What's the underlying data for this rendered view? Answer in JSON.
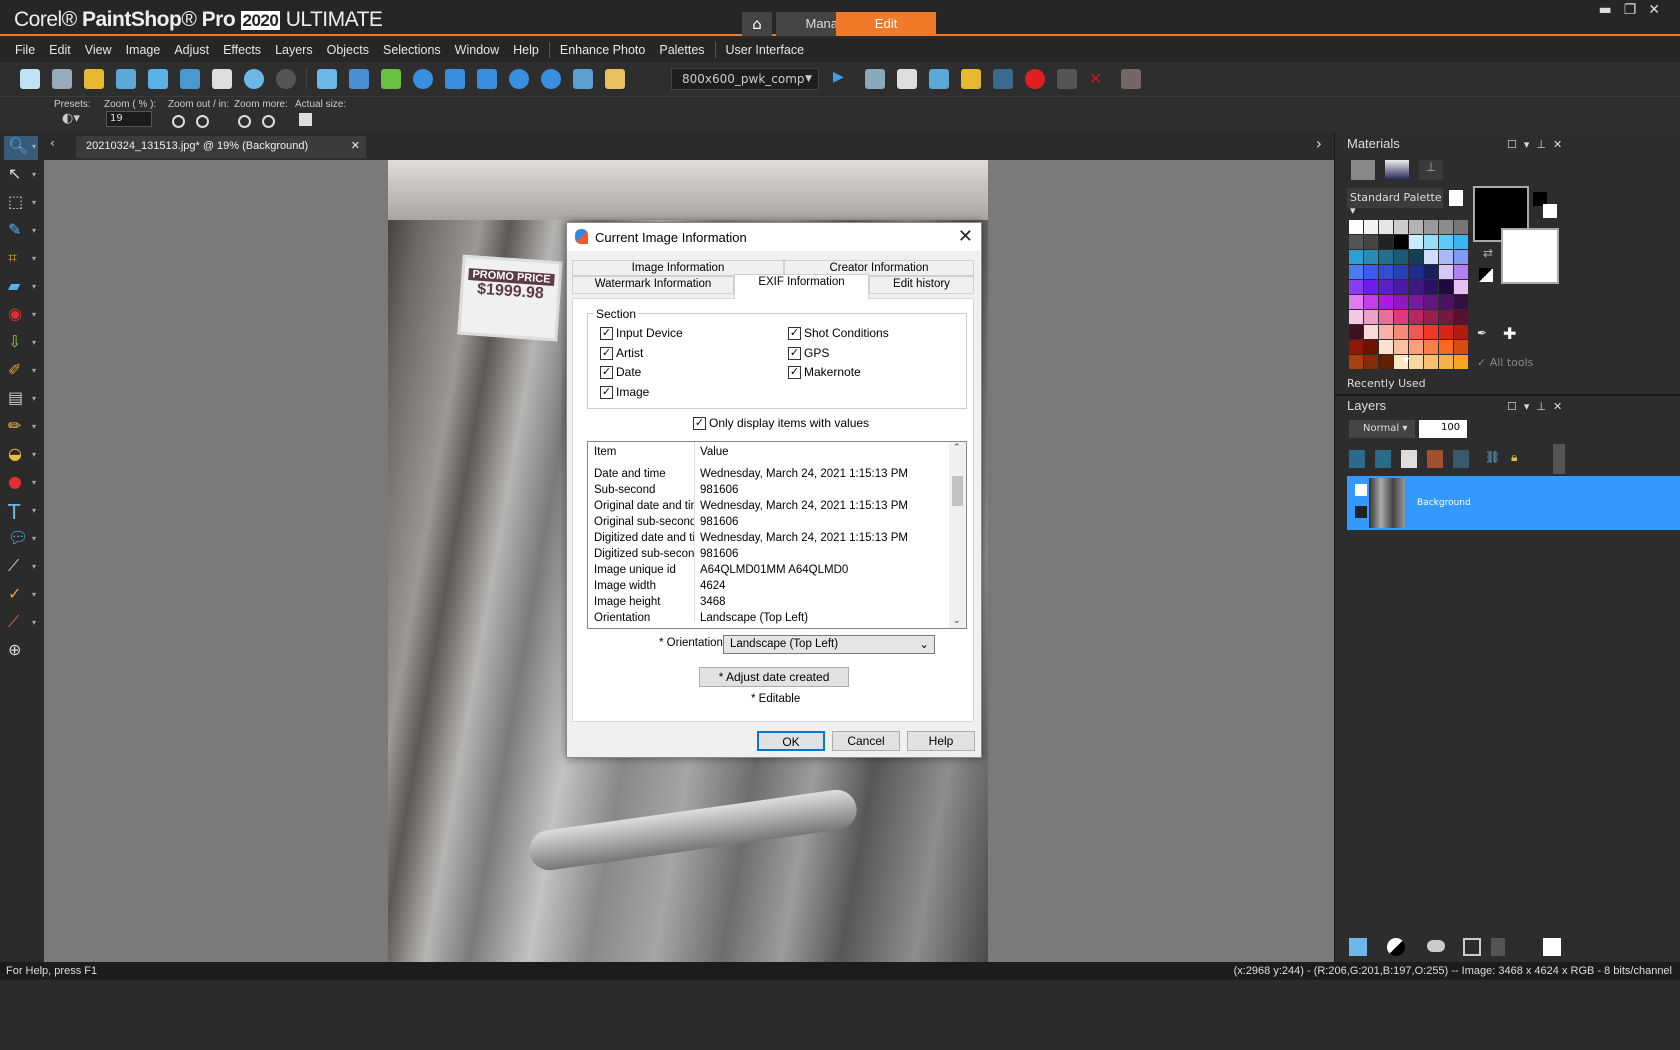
{
  "app": {
    "brand": "Corel",
    "product": "PaintShop",
    "pro": "Pro",
    "year": "2020",
    "edition": "ULTIMATE",
    "accent": "#f07a28"
  },
  "workspace_tabs": [
    {
      "label": "Manage",
      "active": false
    },
    {
      "label": "Edit",
      "active": true
    }
  ],
  "menu": [
    "File",
    "Edit",
    "View",
    "Image",
    "Adjust",
    "Effects",
    "Layers",
    "Objects",
    "Selections",
    "Window",
    "Help",
    "Enhance Photo",
    "Palettes",
    "User Interface"
  ],
  "toolbar": {
    "script_select": "800x600_pwk_comp"
  },
  "options": {
    "presets_label": "Presets:",
    "zoom_label": "Zoom ( % ):",
    "zoom_value": "19",
    "zoom_outin_label": "Zoom out / in:",
    "zoom_more_label": "Zoom more:",
    "actual_size_label": "Actual size:"
  },
  "document": {
    "tab_label": "20210324_131513.jpg* @  19% (Background)"
  },
  "photo": {
    "tag_title": "PROMO PRICE",
    "tag_price": "$1999.98"
  },
  "dialog": {
    "title": "Current Image Information",
    "tabs_row1": [
      "Image Information",
      "Creator Information"
    ],
    "tabs_row2": [
      "Watermark Information",
      "EXIF Information",
      "Edit history"
    ],
    "active_tab": "EXIF Information",
    "section_label": "Section",
    "sections_left": [
      {
        "label": "Input Device",
        "checked": true
      },
      {
        "label": "Artist",
        "checked": true
      },
      {
        "label": "Date",
        "checked": true
      },
      {
        "label": "Image",
        "checked": true
      }
    ],
    "sections_right": [
      {
        "label": "Shot Conditions",
        "checked": true
      },
      {
        "label": "GPS",
        "checked": true
      },
      {
        "label": "Makernote",
        "checked": true
      }
    ],
    "only_values": {
      "label": "Only display items with values",
      "checked": true
    },
    "columns": [
      "Item",
      "Value"
    ],
    "rows": [
      [
        "Date and time",
        "Wednesday, March 24, 2021 1:15:13 PM"
      ],
      [
        "Sub-second",
        "981606"
      ],
      [
        "Original date and time",
        "Wednesday, March 24, 2021 1:15:13 PM"
      ],
      [
        "Original sub-second",
        "981606"
      ],
      [
        "Digitized date and ti...",
        "Wednesday, March 24, 2021 1:15:13 PM"
      ],
      [
        "Digitized sub-second",
        "981606"
      ],
      [
        "Image unique id",
        "A64QLMD01MM A64QLMD0"
      ],
      [
        "Image width",
        "4624"
      ],
      [
        "Image height",
        "3468"
      ],
      [
        "Orientation",
        "Landscape (Top Left)"
      ]
    ],
    "orientation_label": "* Orientation",
    "orientation_value": "Landscape (Top Left)",
    "adjust_date_button": "* Adjust date created",
    "editable_note": "* Editable",
    "ok": "OK",
    "cancel": "Cancel",
    "help": "Help"
  },
  "materials": {
    "title": "Materials",
    "palette_select": "Standard Palette",
    "all_tools": "All tools",
    "recently_used": "Recently Used",
    "foreground": "#000000",
    "background": "#ffffff",
    "swatches": [
      "#ffffff",
      "#f2f2f2",
      "#e6e6e6",
      "#cccccc",
      "#b3b3b3",
      "#999999",
      "#8c8c8c",
      "#777777",
      "#555555",
      "#444444",
      "#222222",
      "#000000",
      "#c8ecfc",
      "#99def9",
      "#5ccbf5",
      "#3ab3f0",
      "#2c9fd6",
      "#2a8ab8",
      "#256f90",
      "#1d5a75",
      "#153f55",
      "#d0dcfc",
      "#aab9fa",
      "#7f9af5",
      "#4a7af0",
      "#3a5cf0",
      "#2f4fd0",
      "#2840b0",
      "#202e90",
      "#18215e",
      "#d8c8fc",
      "#b080f5",
      "#8a3cf0",
      "#6a1ee8",
      "#5a20c0",
      "#4a1ca0",
      "#3c1880",
      "#2a1260",
      "#1e0c40",
      "#e8c0f8",
      "#e07cf0",
      "#c83cf0",
      "#b018e8",
      "#9018c0",
      "#7a18a0",
      "#621880",
      "#4a1460",
      "#341040",
      "#f4c8e0",
      "#f0a0c8",
      "#e87098",
      "#e03880",
      "#b82860",
      "#982050",
      "#781840",
      "#581030",
      "#401020",
      "#fcd8d8",
      "#f8b0a8",
      "#f88878",
      "#f05850",
      "#f03828",
      "#d82418",
      "#b01c10",
      "#901808",
      "#701000",
      "#fce0d0",
      "#f8c0a0",
      "#f8a078",
      "#f88048",
      "#f86820",
      "#d84c10",
      "#a84010",
      "#803008",
      "#602000",
      "#fce8c8",
      "#fcd8a0",
      "#f8c070",
      "#f8b048",
      "#f8a820"
    ]
  },
  "layers": {
    "title": "Layers",
    "blend_mode": "Normal",
    "opacity": "100",
    "items": [
      {
        "name": "Background",
        "selected": true
      }
    ]
  },
  "status": {
    "left": "For Help, press F1",
    "right": "(x:2968 y:244) - (R:206,G:201,B:197,O:255) -- Image:  3468 x 4624 x RGB - 8 bits/channel"
  }
}
